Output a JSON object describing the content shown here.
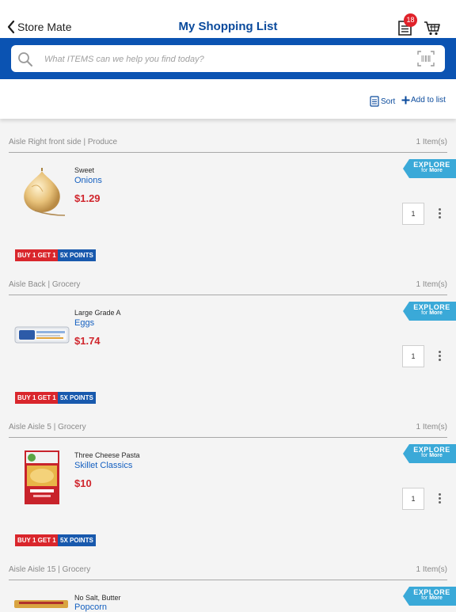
{
  "header": {
    "back_label": "Store Mate",
    "title": "My Shopping List",
    "list_badge_count": "18"
  },
  "search": {
    "placeholder": "What ITEMS can we help you find today?"
  },
  "toolbar": {
    "sort_label": "Sort",
    "add_label": "Add to list"
  },
  "explore": {
    "line1": "EXPLORE",
    "for": "for",
    "more": "More"
  },
  "sections": [
    {
      "aisle": "Aisle Right front side | Produce",
      "count": "1 Item(s)",
      "item": {
        "desc": "Sweet",
        "name": "Onions",
        "price": "$1.29",
        "qty": "1",
        "tags": [
          "BUY 1 GET 1",
          "5X POINTS"
        ]
      }
    },
    {
      "aisle": "Aisle Back | Grocery",
      "count": "1 Item(s)",
      "item": {
        "desc": "Large Grade A",
        "name": "Eggs",
        "price": "$1.74",
        "qty": "1",
        "tags": [
          "BUY 1 GET 1",
          "5X POINTS"
        ]
      }
    },
    {
      "aisle": "Aisle Aisle 5 | Grocery",
      "count": "1 Item(s)",
      "item": {
        "desc": "Three Cheese Pasta",
        "name": "Skillet Classics",
        "price": "$10",
        "qty": "1",
        "tags": [
          "BUY 1 GET 1",
          "5X POINTS"
        ]
      }
    },
    {
      "aisle": "Aisle Aisle 15 | Grocery",
      "count": "1 Item(s)",
      "item": {
        "desc": "No Salt, Butter",
        "name": "Popcorn"
      }
    }
  ],
  "colors": {
    "brand_blue": "#0b53b2",
    "title_blue": "#0a4a9c",
    "price_red": "#d0262d",
    "explore_cyan": "#3aa9d8",
    "badge_red": "#e0222a"
  }
}
